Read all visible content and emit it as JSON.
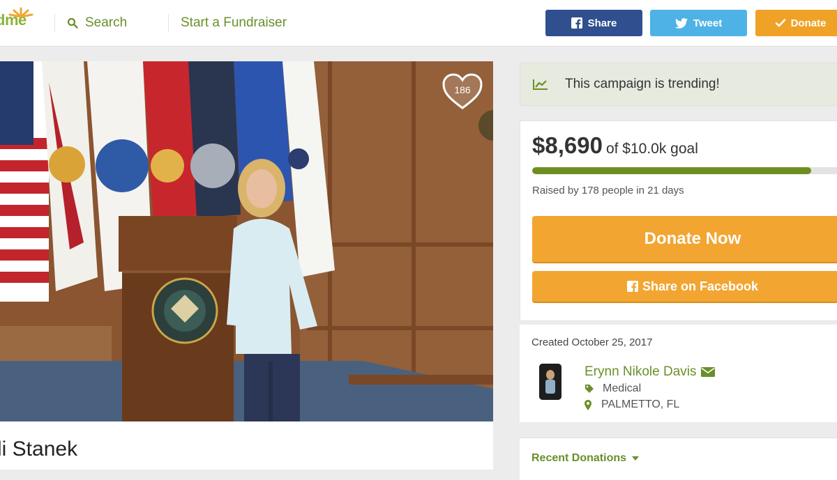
{
  "brand": {
    "logo_text": "dme"
  },
  "header": {
    "search_label": "Search",
    "start_label": "Start a Fundraiser",
    "share_label": "Share",
    "tweet_label": "Tweet",
    "donate_label": "Donate"
  },
  "campaign": {
    "heart_count": "186",
    "name": "li Stanek"
  },
  "trending": {
    "text": "This campaign is trending!"
  },
  "funding": {
    "amount": "$8,690",
    "goal": "of $10.0k goal",
    "progress_fraction": 0.869,
    "raised_by": "Raised by 178 people in 21 days",
    "donate_now": "Donate Now",
    "share_facebook": "Share on Facebook"
  },
  "organizer": {
    "created": "Created October 25, 2017",
    "name": "Erynn Nikole Davis",
    "category": "Medical",
    "location": "PALMETTO, FL"
  },
  "recent": {
    "label": "Recent Donations"
  },
  "colors": {
    "brand_green": "#6a8f2a",
    "facebook_blue": "#2f4f8f",
    "twitter_blue": "#4fb2e6",
    "donate_orange": "#f2a531",
    "progress_green": "#6e8f20"
  },
  "icons": {
    "search": "search-icon",
    "facebook": "facebook-icon",
    "twitter": "twitter-icon",
    "check": "check-icon",
    "heart": "heart-icon",
    "trend": "trending-chart-icon",
    "envelope": "envelope-icon",
    "tag": "tag-icon",
    "location": "location-pin-icon",
    "caret": "caret-down-icon"
  }
}
